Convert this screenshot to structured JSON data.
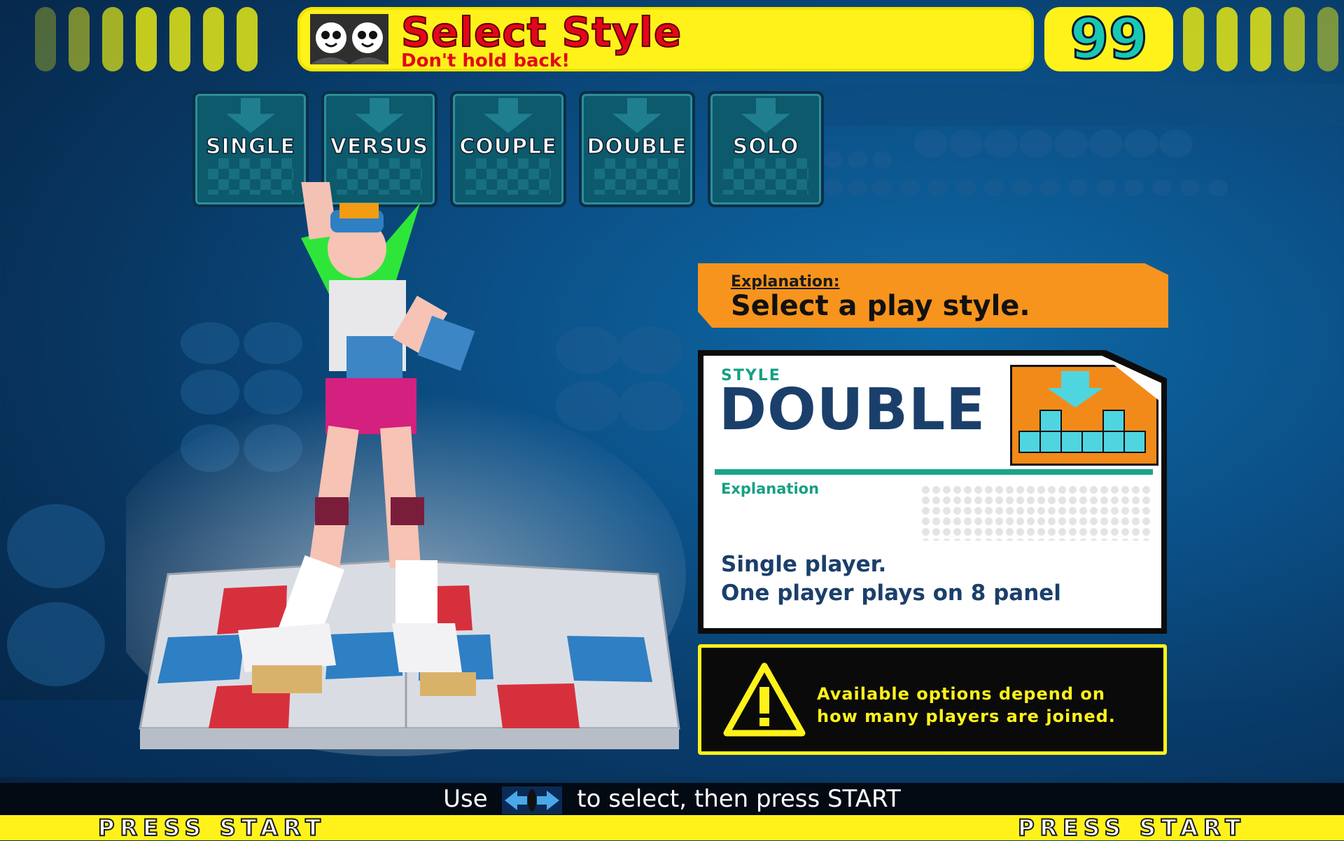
{
  "header": {
    "title": "Select Style",
    "subtitle": "Don't hold back!",
    "timer": "99",
    "icon": "two-player-faces-icon"
  },
  "styles": [
    {
      "label": "SINGLE"
    },
    {
      "label": "VERSUS"
    },
    {
      "label": "COUPLE"
    },
    {
      "label": "DOUBLE",
      "selected": true
    },
    {
      "label": "SOLO"
    }
  ],
  "explanation_header": {
    "label": "Explanation:",
    "text": "Select a play style."
  },
  "style_card": {
    "style_label": "STYLE",
    "style_name": "DOUBLE",
    "explanation_label": "Explanation",
    "line1": "Single player.",
    "line2": "One player plays on 8 panel"
  },
  "warning": {
    "line1": "Available options depend on",
    "line2": "how many players are joined.",
    "icon": "warning-triangle-icon"
  },
  "bottom": {
    "instr_prefix": "Use",
    "instr_suffix": "to select, then press START",
    "press_start_left": "PRESS START",
    "press_start_right": "PRESS START"
  },
  "colors": {
    "accent_yellow": "#fff21a",
    "title_red": "#e3061a",
    "timer_teal": "#18c8b3",
    "orange": "#f7941d",
    "navy": "#1b3f6b",
    "teal": "#16a085"
  }
}
